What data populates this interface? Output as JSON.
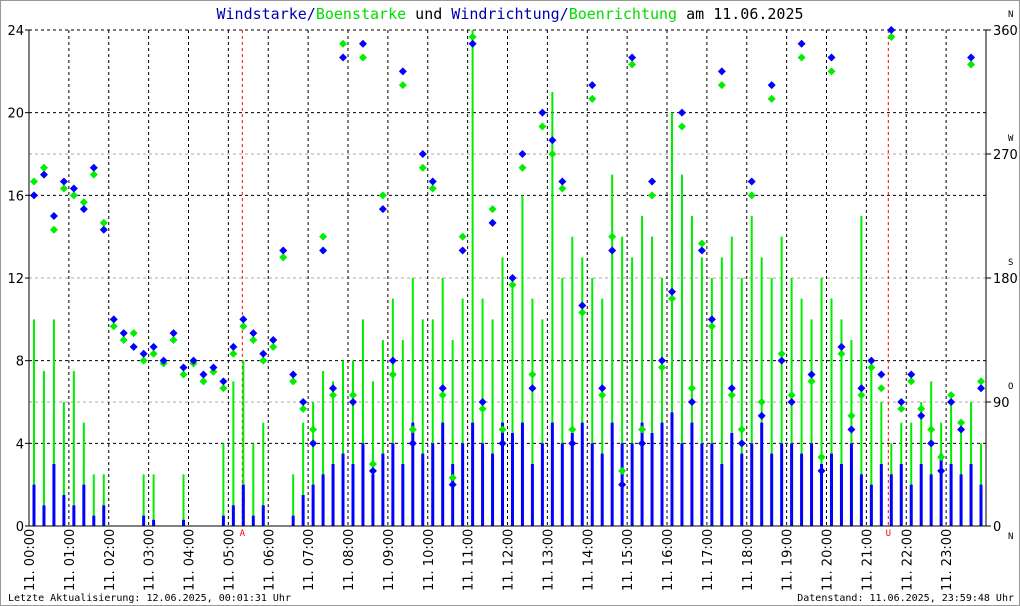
{
  "title": {
    "part1": "Windstarke",
    "sep1": "/",
    "part2": "Boenstarke",
    "part3": " und ",
    "part4": "Windrichtung",
    "sep2": "/",
    "part5": "Boenrichtung",
    "part6": " am 11.06.2025"
  },
  "footer": {
    "left": "Letzte Aktualisierung: 12.06.2025, 00:01:31 Uhr",
    "right": "Datenstand: 11.06.2025, 23:59:48 Uhr"
  },
  "chart_data": {
    "type": "scatter",
    "title": "Windstarke/Boenstarke und Windrichtung/Boenrichtung am 11.06.2025",
    "x_unit": "hour",
    "xlim": [
      0,
      24
    ],
    "x_tick_labels": [
      "11. 00:00",
      "11. 01:00",
      "11. 02:00",
      "11. 03:00",
      "11. 04:00",
      "11. 05:00",
      "11. 06:00",
      "11. 07:00",
      "11. 08:00",
      "11. 09:00",
      "11. 10:00",
      "11. 11:00",
      "11. 12:00",
      "11. 13:00",
      "11. 14:00",
      "11. 15:00",
      "11. 16:00",
      "11. 17:00",
      "11. 18:00",
      "11. 19:00",
      "11. 20:00",
      "11. 21:00",
      "11. 22:00",
      "11. 23:00"
    ],
    "y_left": {
      "ylim": [
        0,
        24
      ],
      "ticks": [
        "0",
        "4",
        "8",
        "12",
        "16",
        "20",
        "24"
      ]
    },
    "y_right": {
      "ylim": [
        0,
        360
      ],
      "ticks": [
        "0",
        "90",
        "180",
        "270",
        "360"
      ],
      "compass": [
        "N",
        "O",
        "S",
        "W",
        "N"
      ]
    },
    "markers": [
      {
        "label": "A",
        "hour": 5.35,
        "color": "#ff0000"
      },
      {
        "label": "U",
        "hour": 21.55,
        "color": "#ff0000"
      }
    ],
    "sample_step_hours": 0.25,
    "series": [
      {
        "name": "Boenstarke",
        "color": "#00ee00",
        "kind": "bars",
        "values": [
          10,
          7.5,
          10,
          6,
          7.5,
          5,
          2.5,
          2.5,
          0,
          0,
          0,
          2.5,
          2.5,
          0,
          0,
          2.5,
          0,
          0,
          0,
          4,
          7,
          8,
          4,
          5,
          0,
          0,
          2.5,
          5,
          6,
          7.5,
          7,
          8,
          8,
          10,
          7,
          9,
          11,
          9,
          12,
          10,
          10,
          12,
          9,
          11,
          24,
          11,
          10,
          13,
          12,
          16,
          11,
          10,
          21,
          12,
          14,
          13,
          12,
          11,
          17,
          14,
          13,
          15,
          14,
          12,
          20,
          17,
          15,
          13,
          12,
          13,
          14,
          12,
          15,
          13,
          12,
          14,
          12,
          11,
          10,
          12,
          11,
          10,
          9,
          15,
          8,
          6,
          4,
          5,
          5,
          6,
          7,
          5,
          6,
          5,
          6,
          4
        ]
      },
      {
        "name": "Windstarke",
        "color": "#0000ff",
        "kind": "bars",
        "values": [
          2,
          1,
          3,
          1.5,
          1,
          2,
          0.5,
          1,
          0,
          0,
          0,
          0.5,
          0.3,
          0,
          0,
          0.3,
          0,
          0,
          0,
          0.5,
          1,
          2,
          0.5,
          1,
          0,
          0,
          0.5,
          1.5,
          2,
          2.5,
          3,
          3.5,
          3,
          4,
          2.5,
          3.5,
          4,
          3,
          5,
          3.5,
          4,
          5,
          3,
          4,
          5,
          4,
          3.5,
          5,
          4.5,
          5,
          3,
          4,
          5,
          4,
          4.5,
          5,
          4,
          3.5,
          5,
          4,
          4,
          5,
          4.5,
          5,
          5.5,
          4,
          5,
          4,
          4,
          3,
          4.5,
          3.5,
          4,
          5,
          3.5,
          4,
          4,
          3.5,
          4,
          3,
          3.5,
          3,
          4,
          2.5,
          2,
          3,
          2.5,
          3,
          2,
          3,
          2.5,
          3.5,
          3,
          2.5,
          3,
          2
        ]
      },
      {
        "name": "Boenrichtung",
        "color": "#00ee00",
        "kind": "points",
        "axis": "right",
        "values": [
          250,
          260,
          215,
          245,
          240,
          235,
          255,
          220,
          145,
          135,
          140,
          120,
          125,
          118,
          135,
          110,
          118,
          105,
          112,
          100,
          125,
          145,
          135,
          120,
          130,
          195,
          105,
          85,
          70,
          210,
          95,
          350,
          95,
          340,
          45,
          240,
          110,
          320,
          70,
          260,
          245,
          95,
          35,
          210,
          355,
          85,
          230,
          70,
          175,
          260,
          110,
          290,
          270,
          245,
          70,
          155,
          310,
          95,
          210,
          40,
          335,
          70,
          240,
          115,
          165,
          290,
          100,
          205,
          145,
          320,
          95,
          70,
          240,
          90,
          310,
          125,
          95,
          340,
          105,
          50,
          330,
          125,
          80,
          95,
          115,
          100,
          355,
          85,
          105,
          85,
          70,
          50,
          95,
          75,
          335,
          105
        ]
      },
      {
        "name": "Windrichtung",
        "color": "#0000ff",
        "kind": "points",
        "axis": "right",
        "values": [
          240,
          255,
          225,
          250,
          245,
          230,
          260,
          215,
          150,
          140,
          130,
          125,
          130,
          120,
          140,
          115,
          120,
          110,
          115,
          105,
          130,
          150,
          140,
          125,
          135,
          200,
          110,
          90,
          60,
          200,
          100,
          340,
          90,
          350,
          40,
          230,
          120,
          330,
          60,
          270,
          250,
          100,
          30,
          200,
          350,
          90,
          220,
          60,
          180,
          270,
          100,
          300,
          280,
          250,
          60,
          160,
          320,
          100,
          200,
          30,
          340,
          60,
          250,
          120,
          170,
          300,
          90,
          200,
          150,
          330,
          100,
          60,
          250,
          80,
          320,
          120,
          90,
          350,
          110,
          40,
          340,
          130,
          70,
          100,
          120,
          110,
          360,
          90,
          110,
          80,
          60,
          40,
          90,
          70,
          340,
          100
        ]
      }
    ]
  }
}
